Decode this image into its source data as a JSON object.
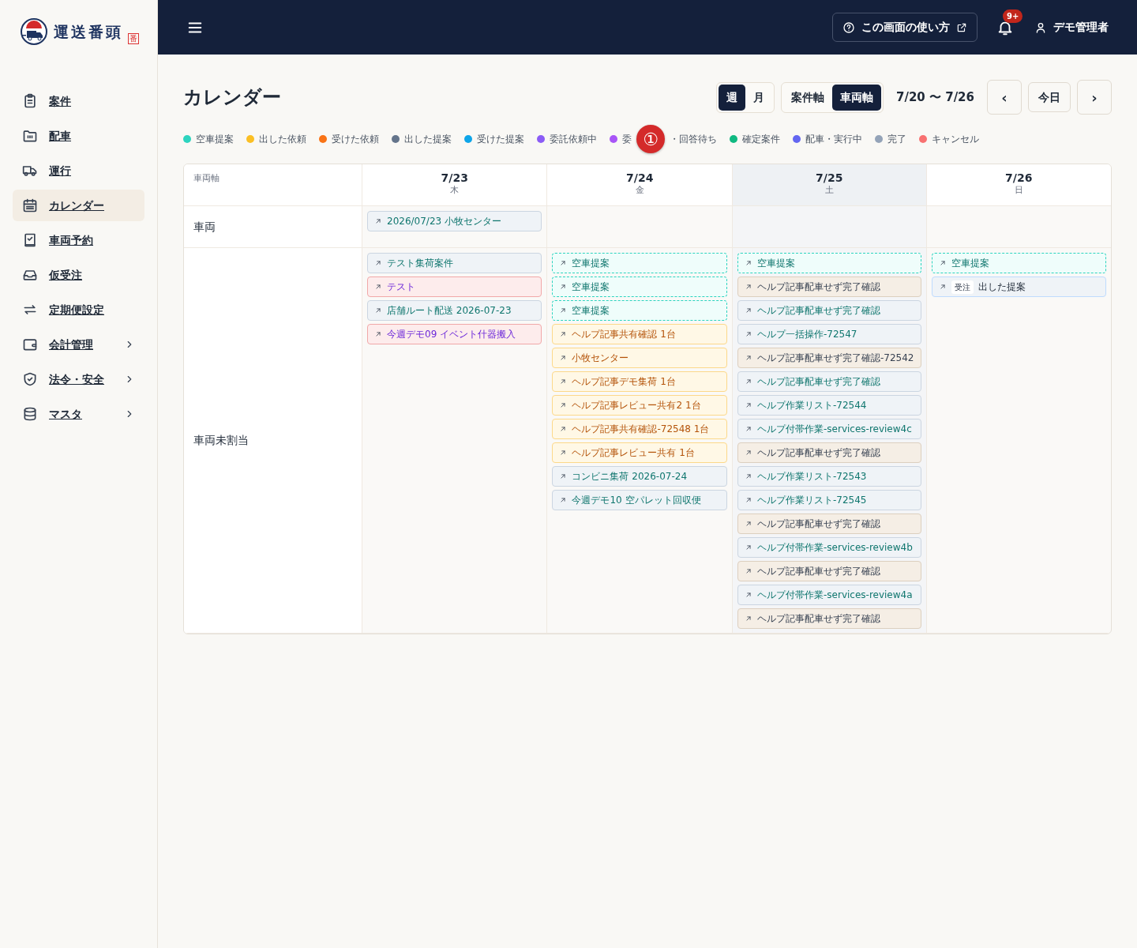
{
  "brand": {
    "name": "運送番頭",
    "seal": "番"
  },
  "sidebar": {
    "items": [
      {
        "label": "案件",
        "selected": false,
        "submenu": false
      },
      {
        "label": "配車",
        "selected": false,
        "submenu": false
      },
      {
        "label": "運行",
        "selected": false,
        "submenu": false
      },
      {
        "label": "カレンダー",
        "selected": true,
        "submenu": false
      },
      {
        "label": "車両予約",
        "selected": false,
        "submenu": false
      },
      {
        "label": "仮受注",
        "selected": false,
        "submenu": false
      },
      {
        "label": "定期便設定",
        "selected": false,
        "submenu": false
      },
      {
        "label": "会計管理",
        "selected": false,
        "submenu": true
      },
      {
        "label": "法令・安全",
        "selected": false,
        "submenu": true
      },
      {
        "label": "マスタ",
        "selected": false,
        "submenu": true
      }
    ]
  },
  "topbar": {
    "help_button": "この画面の使い方",
    "notification_count": "9+",
    "user": "デモ管理者"
  },
  "page": {
    "title": "カレンダー",
    "view_toggle": [
      {
        "label": "週",
        "selected": true
      },
      {
        "label": "月",
        "selected": false
      }
    ],
    "axis_toggle": [
      {
        "label": "案件軸",
        "selected": false
      },
      {
        "label": "車両軸",
        "selected": true
      }
    ],
    "range": "7/20 〜 7/26",
    "prev": "‹",
    "today": "今日",
    "next": "›"
  },
  "legend": [
    {
      "label": "空車提案",
      "color": "#2dd4bf"
    },
    {
      "label": "出した依頼",
      "color": "#fbbf24"
    },
    {
      "label": "受けた依頼",
      "color": "#f97316"
    },
    {
      "label": "出した提案",
      "color": "#64748b"
    },
    {
      "label": "受けた提案",
      "color": "#0ea5e9"
    },
    {
      "label": "委託依頼中",
      "color": "#8b5cf6"
    },
    {
      "label": "委",
      "label_after_marker": "・回答待ち",
      "color": "#a855f7"
    },
    {
      "label": "確定案件",
      "color": "#10b981"
    },
    {
      "label": "配車・実行中",
      "color": "#6366f1"
    },
    {
      "label": "完了",
      "color": "#94a3b8"
    },
    {
      "label": "キャンセル",
      "color": "#f87171"
    }
  ],
  "marker": "①",
  "calendar": {
    "corner": "車両軸",
    "days": [
      {
        "date": "7/23",
        "weekday": "木",
        "shaded": false
      },
      {
        "date": "7/24",
        "weekday": "金",
        "shaded": false
      },
      {
        "date": "7/25",
        "weekday": "土",
        "shaded": true
      },
      {
        "date": "7/26",
        "weekday": "日",
        "shaded": false
      }
    ],
    "rows": [
      {
        "label": "車両",
        "cells": [
          [
            {
              "kind": "case",
              "label": "2026/07/23 小牧センター"
            }
          ],
          [],
          [],
          []
        ]
      },
      {
        "label": "車両未割当",
        "cells": [
          [
            {
              "kind": "case",
              "label": "テスト集荷案件"
            },
            {
              "kind": "cancel",
              "label": "テスト"
            },
            {
              "kind": "case",
              "label": "店舗ルート配送 2026-07-23"
            },
            {
              "kind": "cancel",
              "label": "今週デモ09 イベント什器搬入"
            }
          ],
          [
            {
              "kind": "vacant",
              "label": "空車提案"
            },
            {
              "kind": "vacant",
              "label": "空車提案"
            },
            {
              "kind": "vacant",
              "label": "空車提案"
            },
            {
              "kind": "request",
              "label": "ヘルプ記事共有確認 1台"
            },
            {
              "kind": "request",
              "label": "小牧センター"
            },
            {
              "kind": "request",
              "label": "ヘルプ記事デモ集荷 1台"
            },
            {
              "kind": "request",
              "label": "ヘルプ記事レビュー共有2 1台"
            },
            {
              "kind": "request",
              "label": "ヘルプ記事共有確認-72548 1台"
            },
            {
              "kind": "request",
              "label": "ヘルプ記事レビュー共有 1台"
            },
            {
              "kind": "case",
              "label": "コンビニ集荷 2026-07-24"
            },
            {
              "kind": "case",
              "label": "今週デモ10 空パレット回収便"
            }
          ],
          [
            {
              "kind": "vacant",
              "label": "空車提案"
            },
            {
              "kind": "done",
              "label": "ヘルプ記事配車せず完了確認"
            },
            {
              "kind": "case",
              "label": "ヘルプ記事配車せず完了確認"
            },
            {
              "kind": "case",
              "label": "ヘルプ一括操作-72547"
            },
            {
              "kind": "done",
              "label": "ヘルプ記事配車せず完了確認-72542"
            },
            {
              "kind": "case",
              "label": "ヘルプ記事配車せず完了確認"
            },
            {
              "kind": "case",
              "label": "ヘルプ作業リスト-72544"
            },
            {
              "kind": "case",
              "label": "ヘルプ付帯作業-services-review4c"
            },
            {
              "kind": "done",
              "label": "ヘルプ記事配車せず完了確認"
            },
            {
              "kind": "case",
              "label": "ヘルプ作業リスト-72543"
            },
            {
              "kind": "case",
              "label": "ヘルプ作業リスト-72545"
            },
            {
              "kind": "done",
              "label": "ヘルプ記事配車せず完了確認"
            },
            {
              "kind": "case",
              "label": "ヘルプ付帯作業-services-review4b"
            },
            {
              "kind": "done",
              "label": "ヘルプ記事配車せず完了確認"
            },
            {
              "kind": "case",
              "label": "ヘルプ付帯作業-services-review4a"
            },
            {
              "kind": "done",
              "label": "ヘルプ記事配車せず完了確認"
            }
          ],
          [
            {
              "kind": "vacant",
              "label": "空車提案"
            },
            {
              "kind": "proposal",
              "badge": "受注",
              "label": "出した提案"
            }
          ]
        ]
      }
    ]
  }
}
